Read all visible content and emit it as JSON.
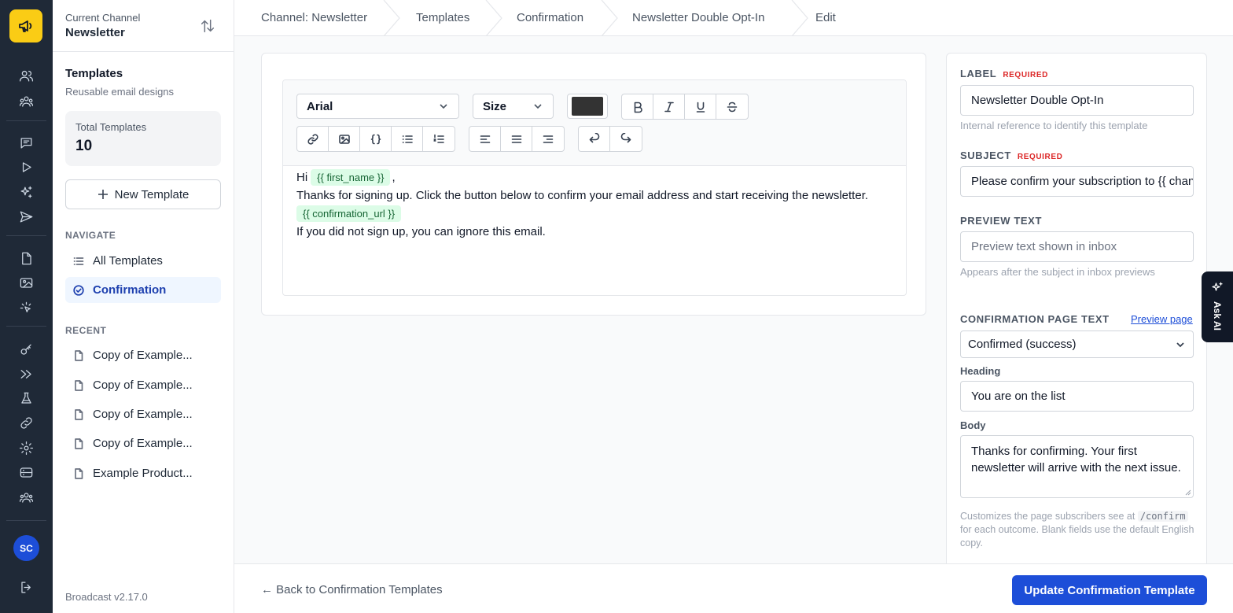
{
  "app": {
    "user_initials": "SC",
    "version": "Broadcast v2.17.0",
    "ask_ai": "Ask AI"
  },
  "channel": {
    "label": "Current Channel",
    "name": "Newsletter"
  },
  "sidebar": {
    "title": "Templates",
    "subtitle": "Reusable email designs",
    "stat_label": "Total Templates",
    "stat_value": "10",
    "new_button": "New Template",
    "nav_heading": "NAVIGATE",
    "nav_items": [
      {
        "label": "All Templates",
        "icon": "list-icon",
        "active": false
      },
      {
        "label": "Confirmation",
        "icon": "check-circle-icon",
        "active": true
      }
    ],
    "recent_heading": "RECENT",
    "recent_items": [
      {
        "label": "Copy of Example..."
      },
      {
        "label": "Copy of Example..."
      },
      {
        "label": "Copy of Example..."
      },
      {
        "label": "Copy of Example..."
      },
      {
        "label": "Example Product..."
      }
    ]
  },
  "breadcrumb": [
    "Channel: Newsletter",
    "Templates",
    "Confirmation",
    "Newsletter Double Opt-In",
    "Edit"
  ],
  "editor": {
    "font": "Arial",
    "size": "Size",
    "text_color": "#333333",
    "greeting": "Hi",
    "first_name_tag": "{{ first_name }}",
    "comma": ",",
    "body_line": "Thanks for signing up. Click the button below to confirm your email address and start receiving the newsletter.",
    "confirmation_tag": "{{ confirmation_url }}",
    "ignore_line": "If you did not sign up, you can ignore this email."
  },
  "form": {
    "label": {
      "title": "LABEL",
      "required": "REQUIRED",
      "value": "Newsletter Double Opt-In",
      "hint": "Internal reference to identify this template"
    },
    "subject": {
      "title": "SUBJECT",
      "required": "REQUIRED",
      "value": "Please confirm your subscription to {{ channel_name }}"
    },
    "preview_text": {
      "title": "PREVIEW TEXT",
      "placeholder": "Preview text shown in inbox",
      "hint": "Appears after the subject in inbox previews"
    },
    "confirmation_page": {
      "title": "CONFIRMATION PAGE TEXT",
      "preview_link": "Preview page",
      "selected": "Confirmed (success)",
      "heading_label": "Heading",
      "heading_value": "You are on the list",
      "body_label": "Body",
      "body_value": "Thanks for confirming. Your first newsletter will arrive with the next issue.",
      "help_prefix": "Customizes the page subscribers see at",
      "help_code": "/confirm",
      "help_suffix": "for each outcome. Blank fields use the default English copy."
    }
  },
  "footer": {
    "back_link": "← Back to Confirmation Templates",
    "update_button": "Update Confirmation Template"
  },
  "colors": {
    "accent": "#1d4ed8",
    "logo": "#facc15",
    "rail": "#1f2937",
    "tag_bg": "#dcfce7",
    "tag_text": "#166534",
    "required": "#dc2626"
  }
}
